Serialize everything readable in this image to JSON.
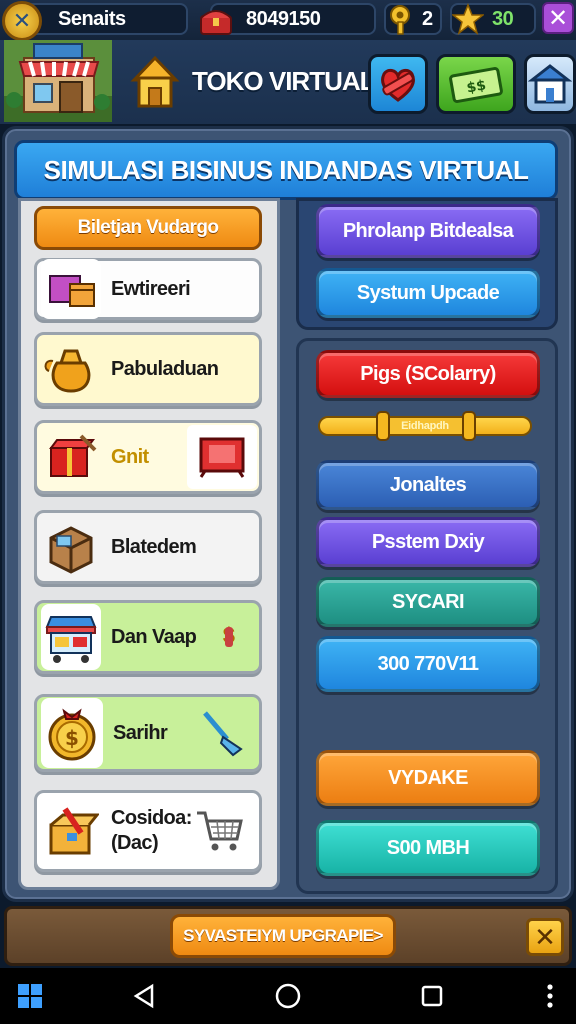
{
  "topbar": {
    "player_name": "Senaits",
    "coins": "8049150",
    "key_count": "2",
    "stars": "30"
  },
  "header": {
    "title": "TOKO VIRTUAL",
    "icons": [
      "heart-badge-icon",
      "cash-icon",
      "shop-icon"
    ]
  },
  "panel": {
    "title": "SIMULASI BISINUS INDANDAS VIRTUAL"
  },
  "left": {
    "tab_label": "Biletjan Vudargo",
    "cards": [
      {
        "label": "Ewtireeri",
        "icon": "crate-icon"
      },
      {
        "label": "Pabuladuan",
        "icon": "money-bag-icon"
      },
      {
        "label": "Gnit",
        "icon": "red-box-icon"
      },
      {
        "label": "Blatedem",
        "icon": "cardboard-box-icon"
      },
      {
        "label": "Dan Vaap",
        "icon": "market-stall-icon"
      },
      {
        "label": "Sarihr",
        "icon": "coin-icon"
      },
      {
        "label_line1": "Cosidoa:",
        "label_line2": "(Dac)",
        "icon": "package-icon"
      }
    ]
  },
  "right": {
    "btn_top1": "Phrolanp Bitdealsa",
    "btn_top2": "Systum Upcade",
    "btn_red": "Pigs (SColarry)",
    "slider_label": "Eidhapdh",
    "slider_value": 0.35,
    "btn_blue1": "Jonaltes",
    "btn_purple": "Psstem Dxiy",
    "btn_teal": "SYCARI",
    "btn_blue2": "300 770V11",
    "btn_orange": "VYDAKE",
    "btn_cyan": "S00 MBH"
  },
  "footer": {
    "upgrade_label": "SYVASTEIYM UPGRAPIE>"
  },
  "colors": {
    "accent": "#1f7fd8",
    "orange": "#f39a1c",
    "red": "#e21b1b",
    "green": "#c8f09a"
  }
}
